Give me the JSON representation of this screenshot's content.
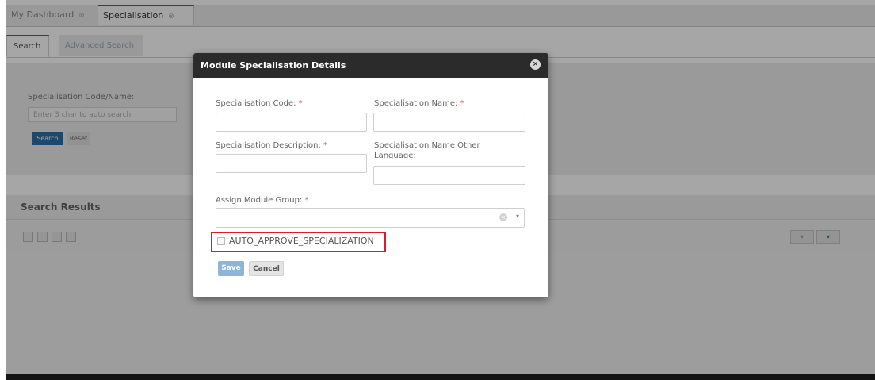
{
  "tabs": {
    "dashboard": "My Dashboard",
    "specialisation": "Specialisation",
    "close_glyph": "⊗"
  },
  "subtabs": {
    "search": "Search",
    "advanced": "Advanced Search"
  },
  "search_panel": {
    "label": "Specialisation Code/Name:",
    "placeholder": "Enter 3 char to auto search",
    "search_button": "Search",
    "reset_button": "Reset"
  },
  "results": {
    "title": "Search Results",
    "export_glyph": "▾"
  },
  "modal": {
    "title": "Module Specialisation Details",
    "close_glyph": "×",
    "fields": {
      "code_label": "Specialisation Code:",
      "name_label": "Specialisation Name:",
      "description_label": "Specialisation Description:",
      "name_other_label": "Specialisation Name Other Language:",
      "module_group_label": "Assign Module Group:",
      "required_marker": "*"
    },
    "checkbox_label": "AUTO_APPROVE_SPECIALIZATION",
    "save_button": "Save",
    "cancel_button": "Cancel"
  },
  "colors": {
    "modal_header": "#2b2b2b",
    "highlight": "#e01b24",
    "required": "#d9534f",
    "save_button": "#8fb4dc"
  }
}
